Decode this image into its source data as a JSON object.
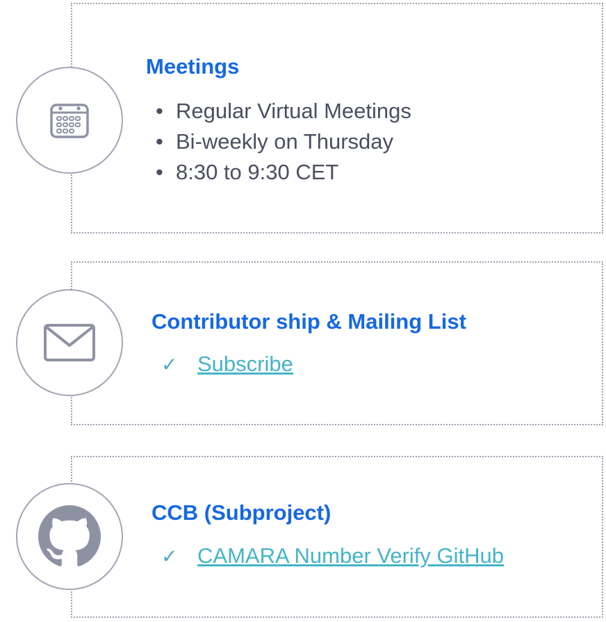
{
  "meetings": {
    "title": "Meetings",
    "items": [
      "Regular Virtual Meetings",
      "Bi-weekly on Thursday",
      "8:30 to 9:30 CET"
    ]
  },
  "mailing": {
    "title": "Contributor ship & Mailing List",
    "check": "✓",
    "link_label": "Subscribe"
  },
  "ccb": {
    "title": "CCB (Subproject)",
    "check": "✓",
    "link_label": "CAMARA Number Verify GitHub"
  },
  "icons": {
    "meetings": "calendar-icon",
    "mailing": "envelope-icon",
    "ccb": "github-icon"
  },
  "colors": {
    "title": "#1668e3",
    "link": "#45b4c7",
    "icon": "#8d92a3",
    "border": "#9a9fae"
  }
}
